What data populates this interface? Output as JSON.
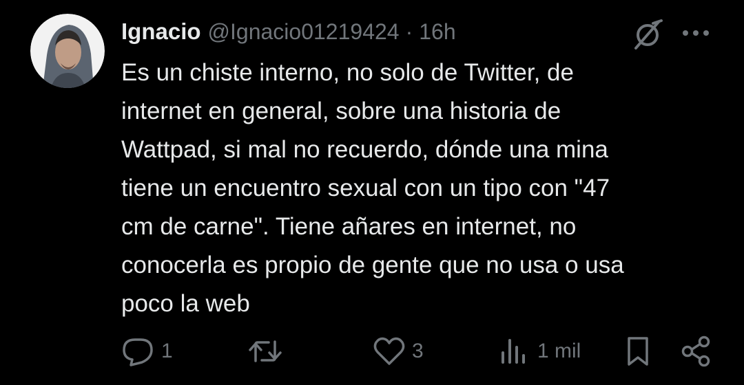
{
  "author": {
    "display_name": "Ignacio",
    "handle": "@Ignacio01219424",
    "separator": "·",
    "time": "16h"
  },
  "tweet": {
    "lines": [
      "Es un chiste interno, no solo de Twitter, de",
      "internet en general, sobre una historia de",
      "Wattpad, si mal no recuerdo, dónde una mina",
      "tiene un encuentro sexual con un tipo con \"47",
      "cm de carne\". Tiene añares en internet, no",
      "conocerla es propio de gente que no usa o usa",
      "poco la web"
    ]
  },
  "actions": {
    "replies": "1",
    "retweets": "",
    "likes": "3",
    "views": "1 mil"
  },
  "icons": {
    "reply": "reply-icon",
    "retweet": "retweet-icon",
    "like": "heart-icon",
    "views": "views-icon",
    "bookmark": "bookmark-icon",
    "share": "share-icon",
    "grok": "grok-icon",
    "more": "more-icon"
  },
  "colors": {
    "background": "#000000",
    "text": "#e7e9ea",
    "secondary": "#71767b"
  }
}
